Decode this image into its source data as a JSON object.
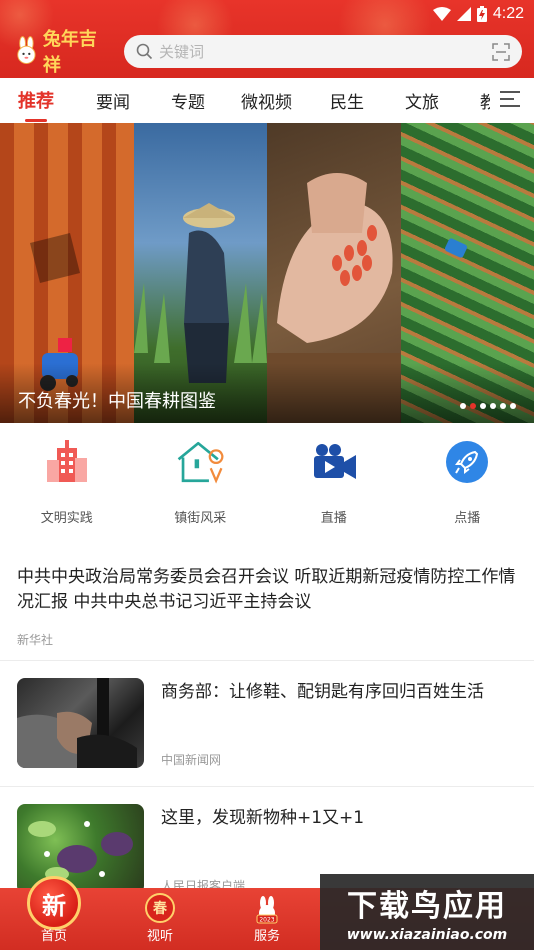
{
  "status_bar": {
    "time": "4:22"
  },
  "header": {
    "logo_text": "兔年吉祥",
    "search_placeholder": "关键词"
  },
  "tabs": [
    {
      "label": "推荐",
      "active": true
    },
    {
      "label": "要闻"
    },
    {
      "label": "专题"
    },
    {
      "label": "微视频"
    },
    {
      "label": "民生"
    },
    {
      "label": "文旅"
    },
    {
      "label": "教"
    }
  ],
  "banner": {
    "title": "不负春光！中国春耕图鉴",
    "dots_total": 6,
    "dots_active": 1
  },
  "quick_nav": [
    {
      "label": "文明实践",
      "icon": "building-icon"
    },
    {
      "label": "镇街风采",
      "icon": "house-location-icon"
    },
    {
      "label": "直播",
      "icon": "video-camera-icon"
    },
    {
      "label": "点播",
      "icon": "rocket-icon"
    }
  ],
  "news": [
    {
      "title": "中共中央政治局常务委员会召开会议 听取近期新冠疫情防控工作情况汇报 中共中央总书记习近平主持会议",
      "source": "新华社"
    },
    {
      "title": "商务部：让修鞋、配钥匙有序回归百姓生活",
      "source": "中国新闻网"
    },
    {
      "title": "这里，发现新物种+1又+1",
      "source": "人民日报客户端"
    }
  ],
  "bottom_nav": [
    {
      "label": "首页",
      "badge": "新"
    },
    {
      "label": "视听",
      "badge": "春"
    },
    {
      "label": "服务",
      "badge": "2023"
    }
  ],
  "watermark": {
    "title": "下载鸟应用",
    "url": "www.xiazainiao.com"
  },
  "colors": {
    "brand": "#e3332a"
  }
}
